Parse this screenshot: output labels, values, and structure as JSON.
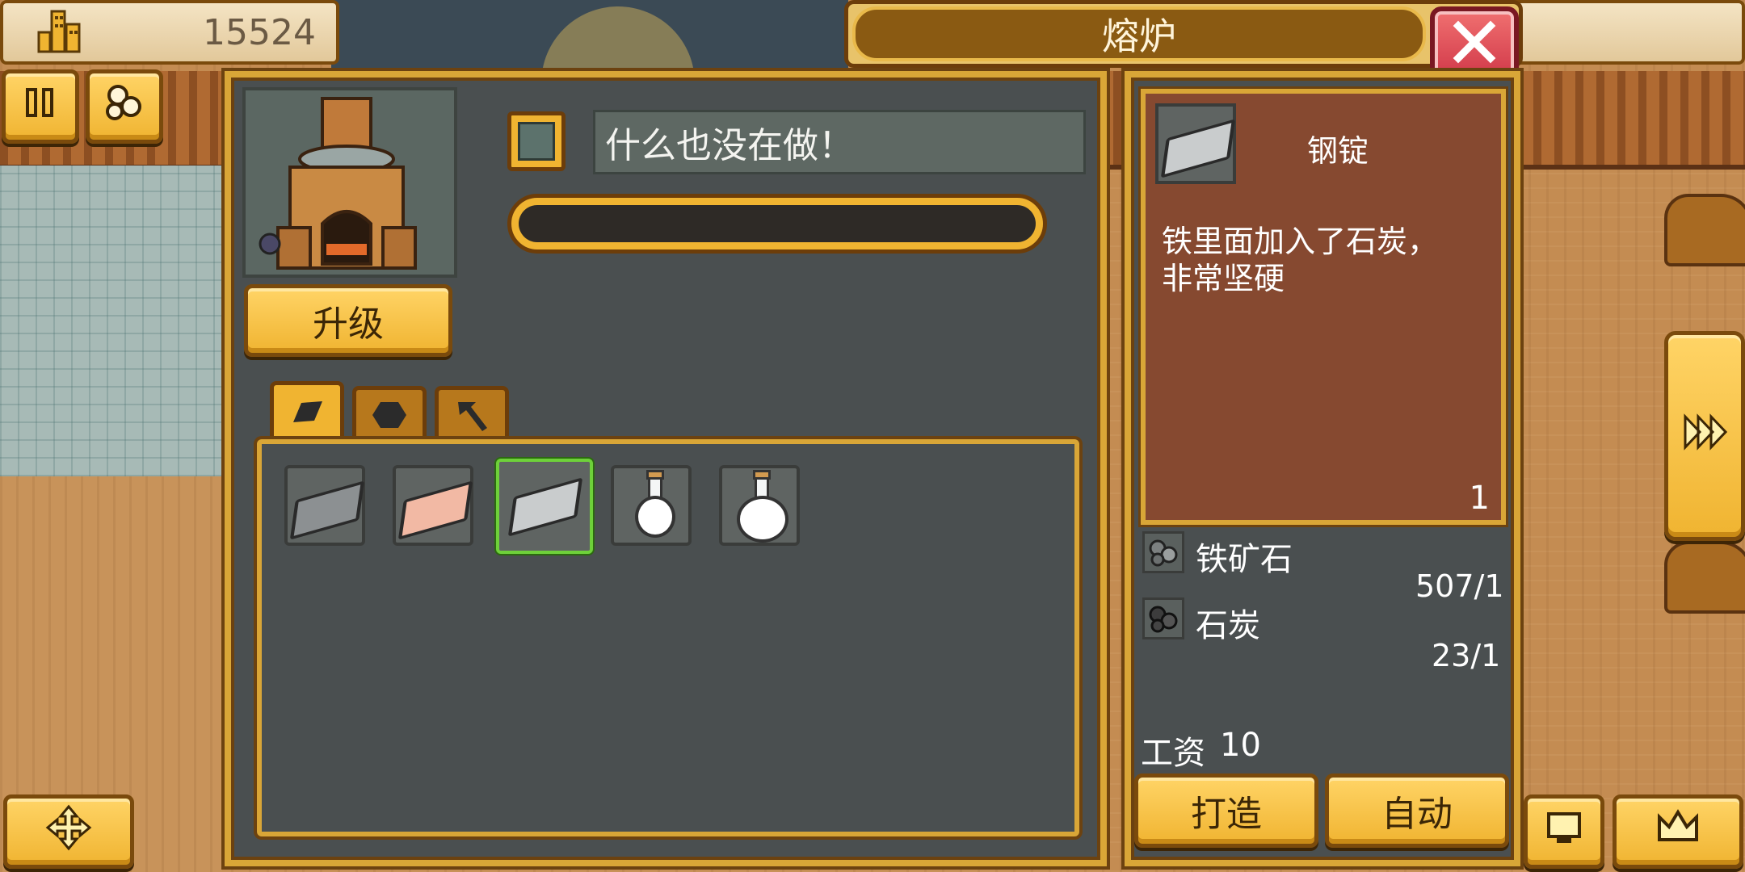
{
  "hud": {
    "coins": "15524"
  },
  "window": {
    "title": "熔炉",
    "status_text": "什么也没在做！",
    "upgrade_label": "升级",
    "progress": 0
  },
  "item_tabs": [
    "ingot-tab",
    "ore-tab",
    "tool-tab"
  ],
  "items": [
    {
      "name": "iron-ingot",
      "color": "#8c9092"
    },
    {
      "name": "copper-ingot",
      "color": "#f2b9a4"
    },
    {
      "name": "steel-ingot",
      "color": "#c9cccd",
      "selected": true
    },
    {
      "name": "small-potion-flask",
      "color": "#ffffff"
    },
    {
      "name": "large-potion-flask",
      "color": "#ffffff"
    }
  ],
  "detail": {
    "item_name": "钢锭",
    "description_line1": "铁里面加入了石炭，",
    "description_line2": "非常坚硬",
    "quantity": "1",
    "materials": [
      {
        "name": "铁矿石",
        "amount": "507/1"
      },
      {
        "name": "石炭",
        "amount": "23/1"
      }
    ],
    "wage_label": "工资",
    "wage_value": "10",
    "craft_label": "打造",
    "auto_label": "自动"
  }
}
